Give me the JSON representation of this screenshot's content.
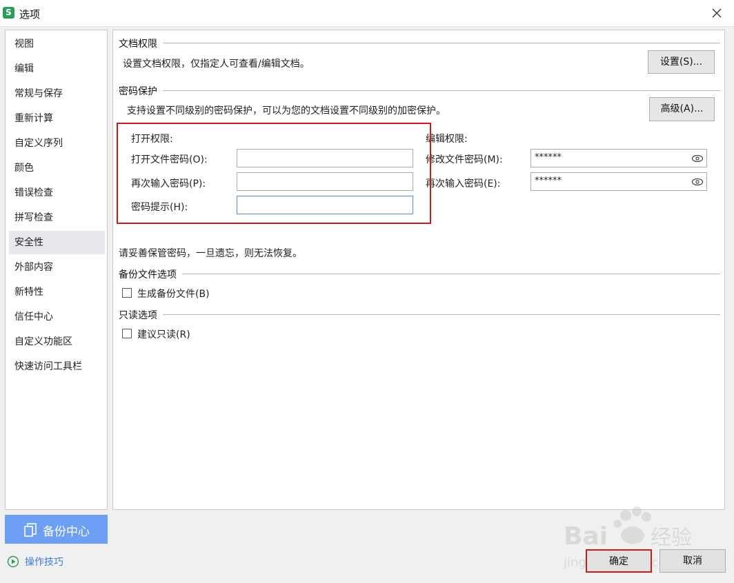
{
  "window": {
    "title": "选项",
    "app_icon": "S"
  },
  "sidebar": {
    "items": [
      {
        "label": "视图"
      },
      {
        "label": "编辑"
      },
      {
        "label": "常规与保存"
      },
      {
        "label": "重新计算"
      },
      {
        "label": "自定义序列"
      },
      {
        "label": "颜色"
      },
      {
        "label": "错误检查"
      },
      {
        "label": "拼写检查"
      },
      {
        "label": "安全性",
        "active": true
      },
      {
        "label": "外部内容"
      },
      {
        "label": "新特性"
      },
      {
        "label": "信任中心"
      },
      {
        "label": "自定义功能区"
      },
      {
        "label": "快速访问工具栏"
      }
    ],
    "backup_button": "备份中心",
    "tips_link": "操作技巧"
  },
  "doc_permission": {
    "title": "文档权限",
    "description": "设置文档权限，仅指定人可查看/编辑文档。",
    "button": "设置(S)..."
  },
  "password_protection": {
    "title": "密码保护",
    "description": "支持设置不同级别的密码保护，可以为您的文档设置不同级别的加密保护。",
    "advanced_button": "高级(A)...",
    "open": {
      "heading": "打开权限:",
      "password_label": "打开文件密码(O):",
      "password_value": "",
      "confirm_label": "再次输入密码(P):",
      "confirm_value": "",
      "hint_label": "密码提示(H):",
      "hint_value": ""
    },
    "edit": {
      "heading": "编辑权限:",
      "password_label": "修改文件密码(M):",
      "password_value": "******",
      "confirm_label": "再次输入密码(E):",
      "confirm_value": "******"
    },
    "warning": "请妥善保管密码，一旦遗忘，则无法恢复。"
  },
  "backup_options": {
    "title": "备份文件选项",
    "checkbox_label": "生成备份文件(B)",
    "checked": false
  },
  "readonly_options": {
    "title": "只读选项",
    "checkbox_label": "建议只读(R)",
    "checked": false
  },
  "footer": {
    "ok": "确定",
    "cancel": "取消"
  },
  "colors": {
    "accent": "#6d9ff5",
    "highlight": "#c8191e",
    "link": "#3d7bd6",
    "brand": "#2d9b5a"
  }
}
